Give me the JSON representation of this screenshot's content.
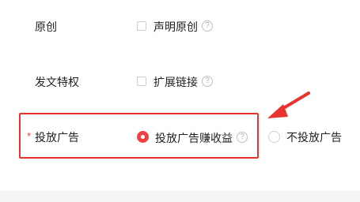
{
  "form": {
    "original": {
      "label": "原创",
      "option_label": "声明原创",
      "checked": false
    },
    "privilege": {
      "label": "发文特权",
      "option_label": "扩展链接",
      "checked": false
    },
    "ads": {
      "required_mark": "*",
      "label": "投放广告",
      "option_on_label": "投放广告赚收益",
      "option_off_label": "不投放广告",
      "selected": "option_on"
    },
    "help_glyph": "?"
  },
  "colors": {
    "accent": "#f04142",
    "annotation": "#e8332e",
    "muted_border": "#cfcfcf"
  }
}
